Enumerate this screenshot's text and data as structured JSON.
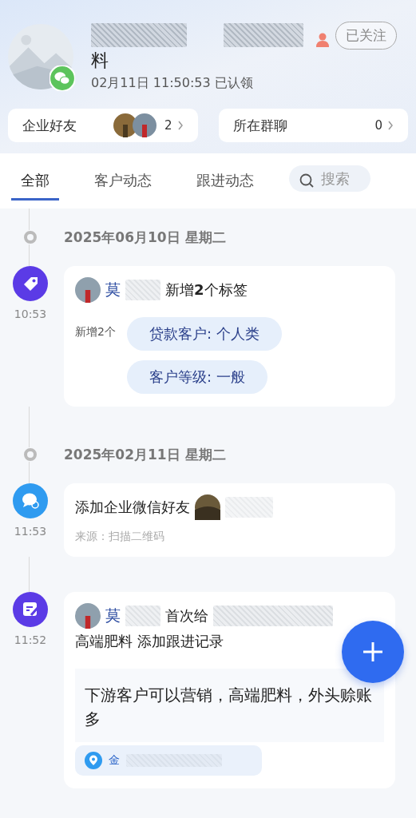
{
  "profile": {
    "name_tail": "料",
    "claimed": "02月11日 11:50:53 已认领",
    "follow_button": "已关注"
  },
  "stats": [
    {
      "label": "企业好友",
      "count": "2"
    },
    {
      "label": "所在群聊",
      "count": "0"
    }
  ],
  "tabs": [
    {
      "label": "全部",
      "selected": true
    },
    {
      "label": "客户动态",
      "selected": false
    },
    {
      "label": "跟进动态",
      "selected": false
    }
  ],
  "search": {
    "placeholder": "搜索"
  },
  "timeline": [
    {
      "date": "2025年06月10日 星期二",
      "events": [
        {
          "kind": "tags",
          "time": "10:53",
          "name": "莫",
          "action": "新增**2**个标签",
          "tags_label": "新增2个",
          "tags": [
            "贷款客户: 个人类",
            "客户等级: 一般"
          ]
        }
      ]
    },
    {
      "date": "2025年02月11日 星期二",
      "events": [
        {
          "kind": "friend",
          "time": "11:53",
          "action": "添加企业微信好友",
          "source": "来源：扫描二维码"
        },
        {
          "kind": "followup",
          "time": "11:52",
          "name": "莫",
          "action": "首次给",
          "line2": "高端肥料 添加跟进记录",
          "note": "下游客户可以营销，高端肥料，外头赊账多",
          "location": "金"
        }
      ]
    }
  ]
}
